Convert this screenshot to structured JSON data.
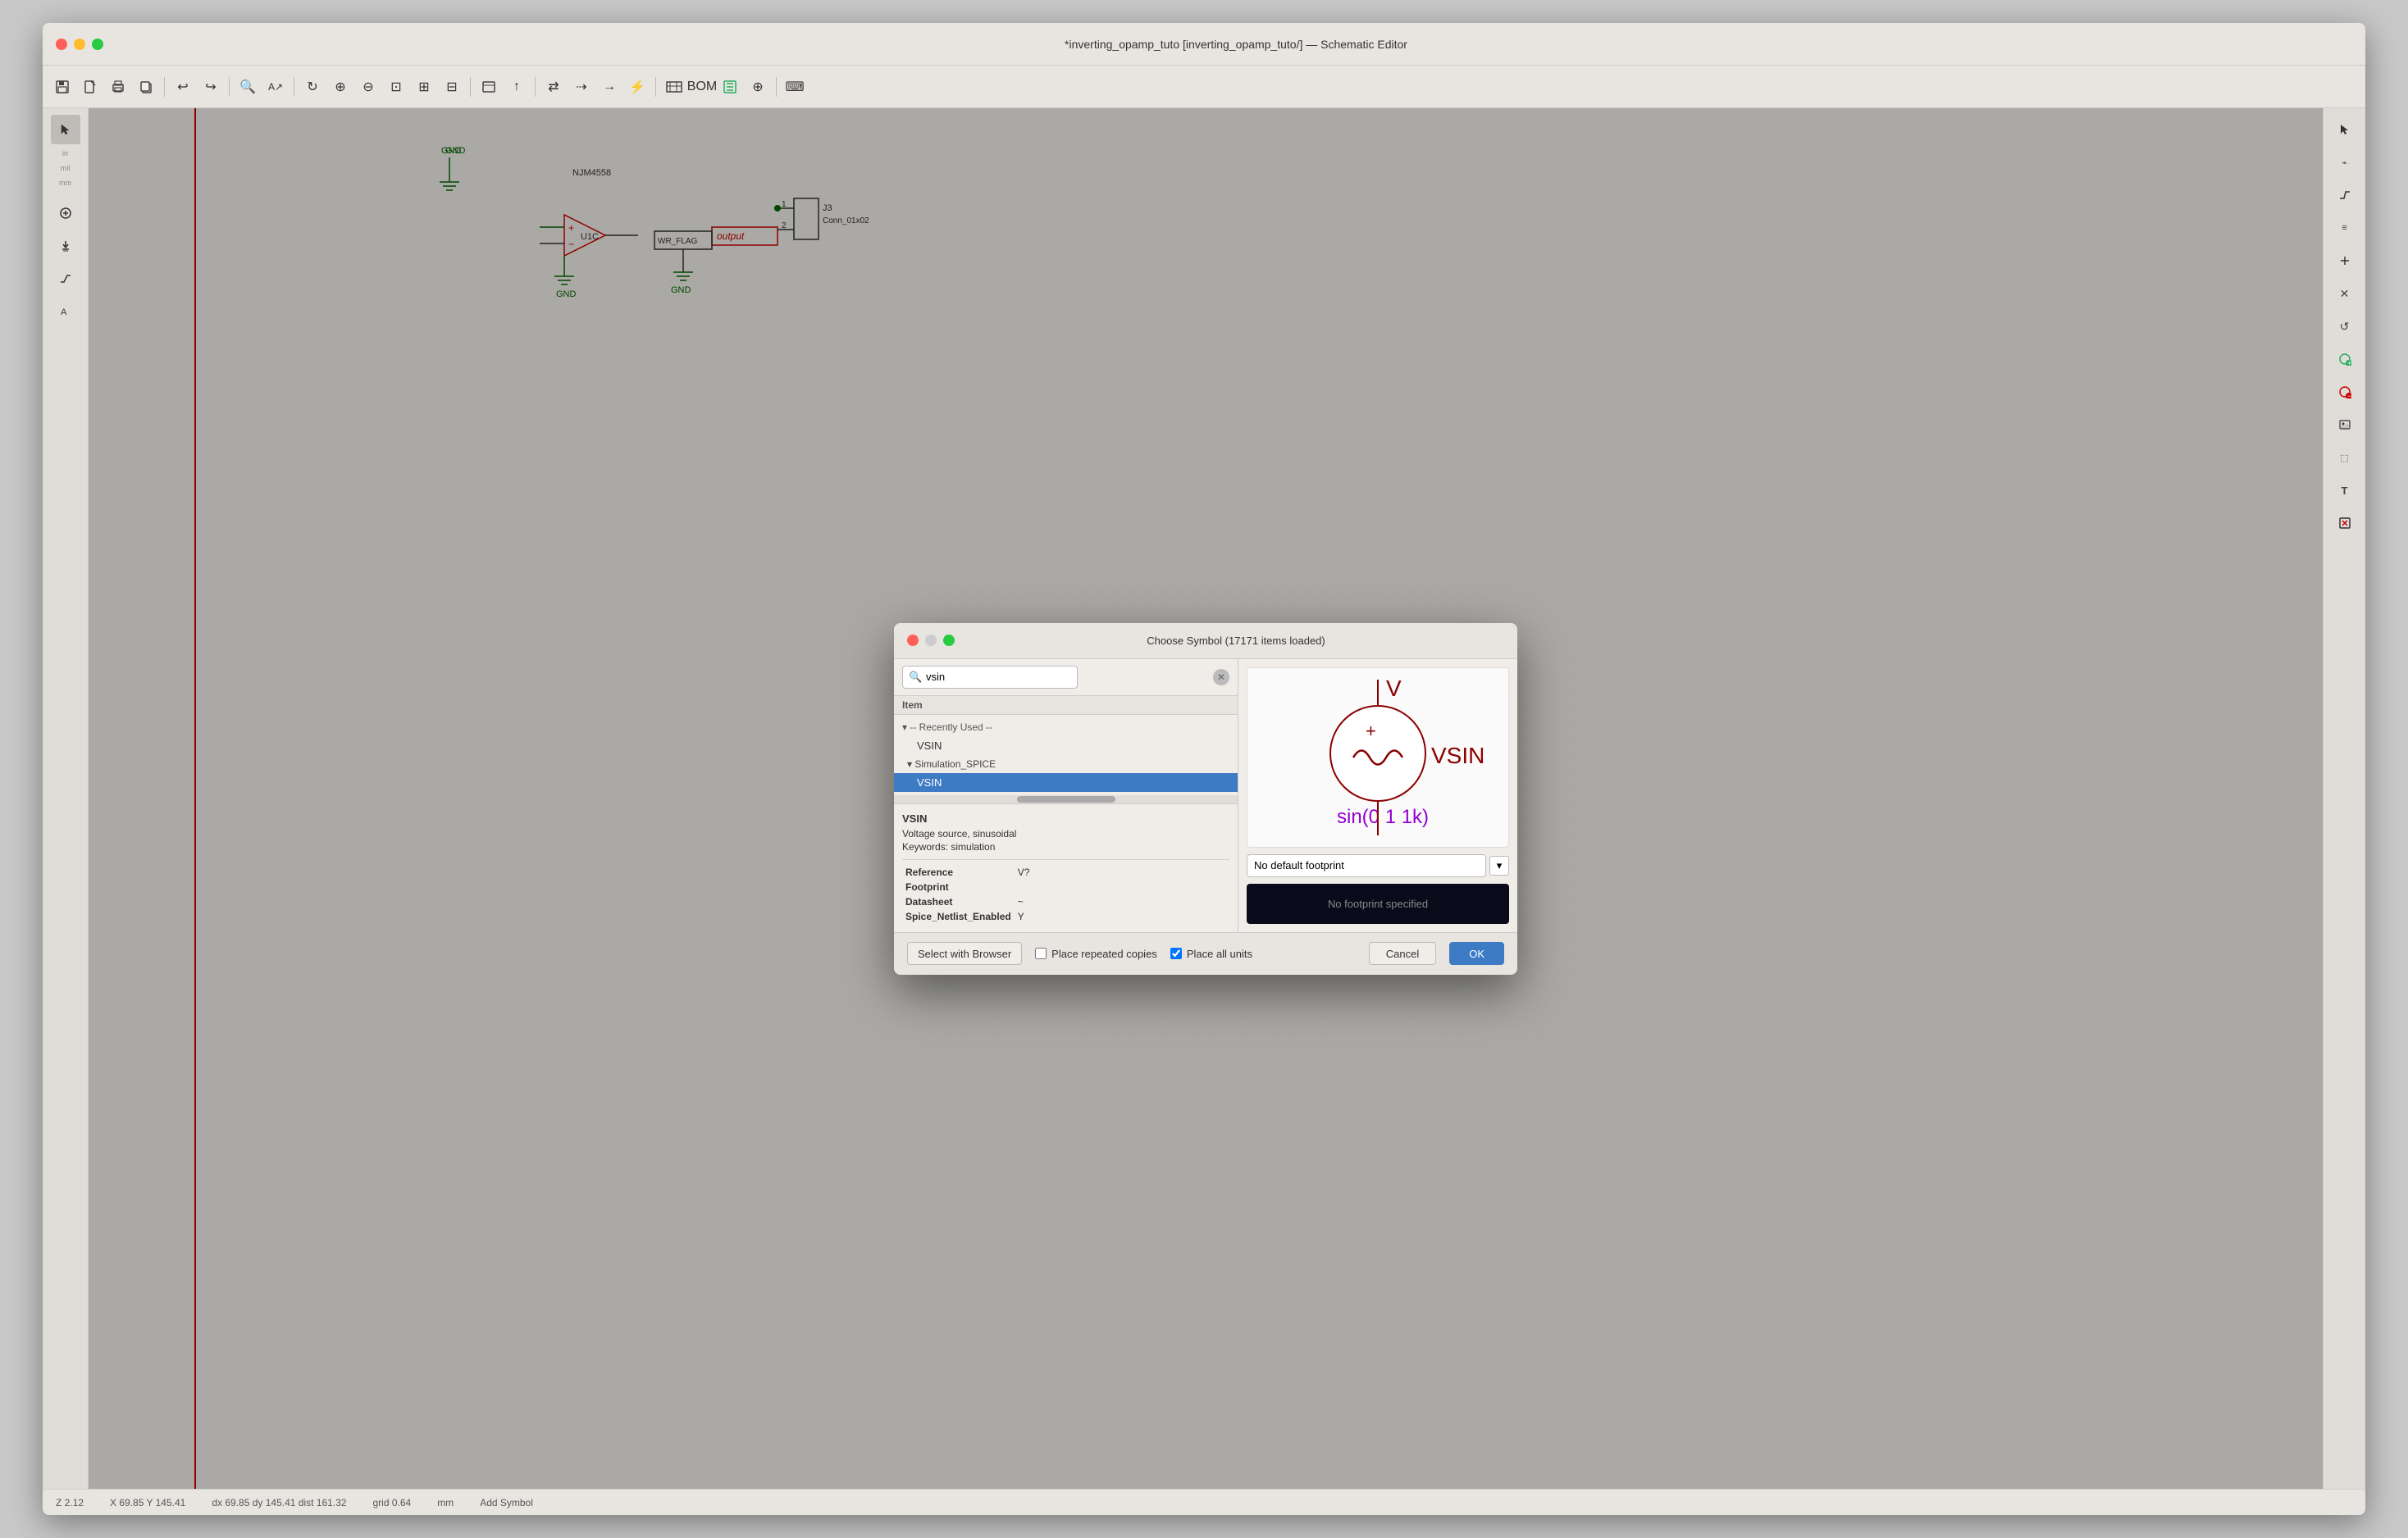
{
  "window": {
    "title": "*inverting_opamp_tuto [inverting_opamp_tuto/] — Schematic Editor",
    "buttons": {
      "close": "×",
      "minimize": "–",
      "maximize": "+"
    }
  },
  "toolbar": {
    "tools": [
      {
        "name": "save",
        "icon": "💾"
      },
      {
        "name": "print",
        "icon": "🖨"
      },
      {
        "name": "copy",
        "icon": "📋"
      },
      {
        "name": "undo",
        "icon": "↩"
      },
      {
        "name": "redo",
        "icon": "↪"
      },
      {
        "name": "find",
        "icon": "🔍"
      },
      {
        "name": "zoom-in",
        "icon": "+"
      },
      {
        "name": "zoom-out",
        "icon": "−"
      },
      {
        "name": "zoom-fit",
        "icon": "⊡"
      },
      {
        "name": "zoom-area",
        "icon": "⊞"
      }
    ]
  },
  "dialog": {
    "title": "Choose Symbol (17171 items loaded)",
    "search": {
      "placeholder": "vsin",
      "value": "vsin"
    },
    "column_header": "Item",
    "tree": {
      "recently_used_label": "▾ -- Recently Used --",
      "recently_used_item": "VSIN",
      "simulation_spice_label": "▾ Simulation_SPICE",
      "simulation_spice_item": "VSIN"
    },
    "symbol_info": {
      "name": "VSIN",
      "description": "Voltage source, sinusoidal",
      "keywords": "Keywords: simulation"
    },
    "properties": {
      "reference_label": "Reference",
      "reference_value": "V?",
      "footprint_label": "Footprint",
      "footprint_value": "",
      "datasheet_label": "Datasheet",
      "datasheet_value": "~",
      "spice_label": "Spice_Netlist_Enabled",
      "spice_value": "Y"
    },
    "footprint_dropdown": {
      "value": "No default footprint",
      "options": [
        "No default footprint"
      ]
    },
    "footprint_preview": "No footprint specified",
    "footer": {
      "select_browser": "Select with Browser",
      "place_repeated": "Place repeated copies",
      "place_repeated_checked": false,
      "place_all_units": "Place all units",
      "place_all_units_checked": true,
      "cancel": "Cancel",
      "ok": "OK"
    }
  },
  "status_bar": {
    "zoom": "Z 2.12",
    "coords": "X 69.85  Y 145.41",
    "delta": "dx 69.85  dy 145.41  dist 161.32",
    "grid": "grid 0.64",
    "units": "mm",
    "mode": "Add Symbol"
  },
  "schematic": {
    "gnd_labels": [
      "GND",
      "GND",
      "GND",
      "GND"
    ],
    "component_refs": [
      "NJM4558",
      "U1C",
      "J3",
      "Conn_01x02"
    ],
    "output_label": "output",
    "wr_flag": "WR_FLAG"
  }
}
